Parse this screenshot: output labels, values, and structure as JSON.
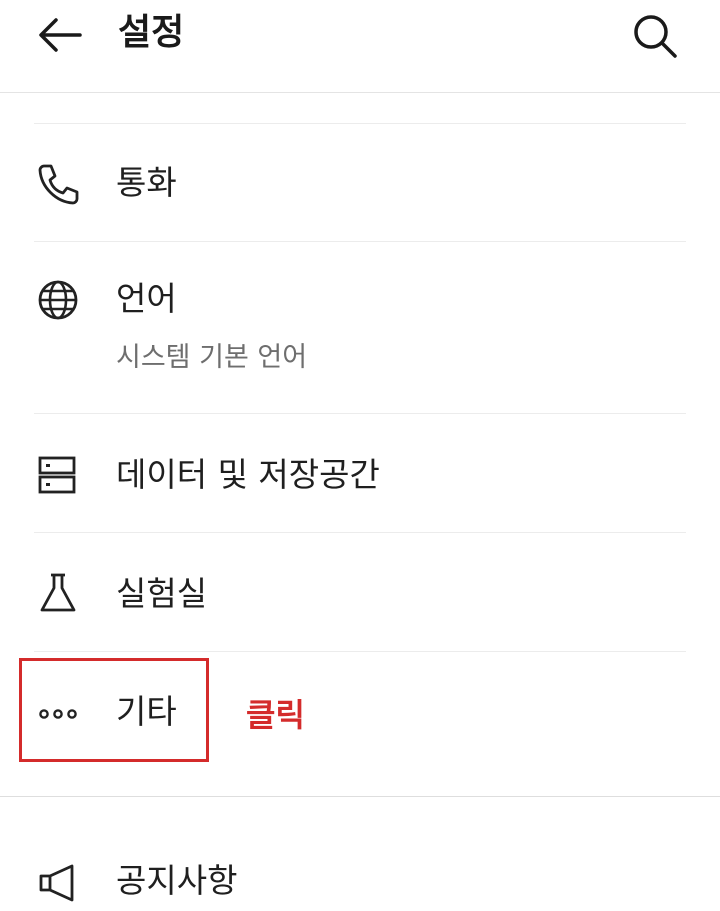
{
  "header": {
    "title": "설정",
    "back_icon": "arrow-left-icon",
    "search_icon": "search-icon"
  },
  "items": [
    {
      "label": "통화",
      "icon": "phone-icon"
    },
    {
      "label": "언어",
      "sub": "시스템 기본 언어",
      "icon": "globe-icon"
    },
    {
      "label": "데이터 및 저장공간",
      "icon": "storage-icon"
    },
    {
      "label": "실험실",
      "icon": "flask-icon"
    },
    {
      "label": "기타",
      "icon": "more-dots-icon"
    },
    {
      "label": "공지사항",
      "icon": "megaphone-icon"
    }
  ],
  "annotation": {
    "note": "클릭",
    "color": "#d42b2b"
  }
}
